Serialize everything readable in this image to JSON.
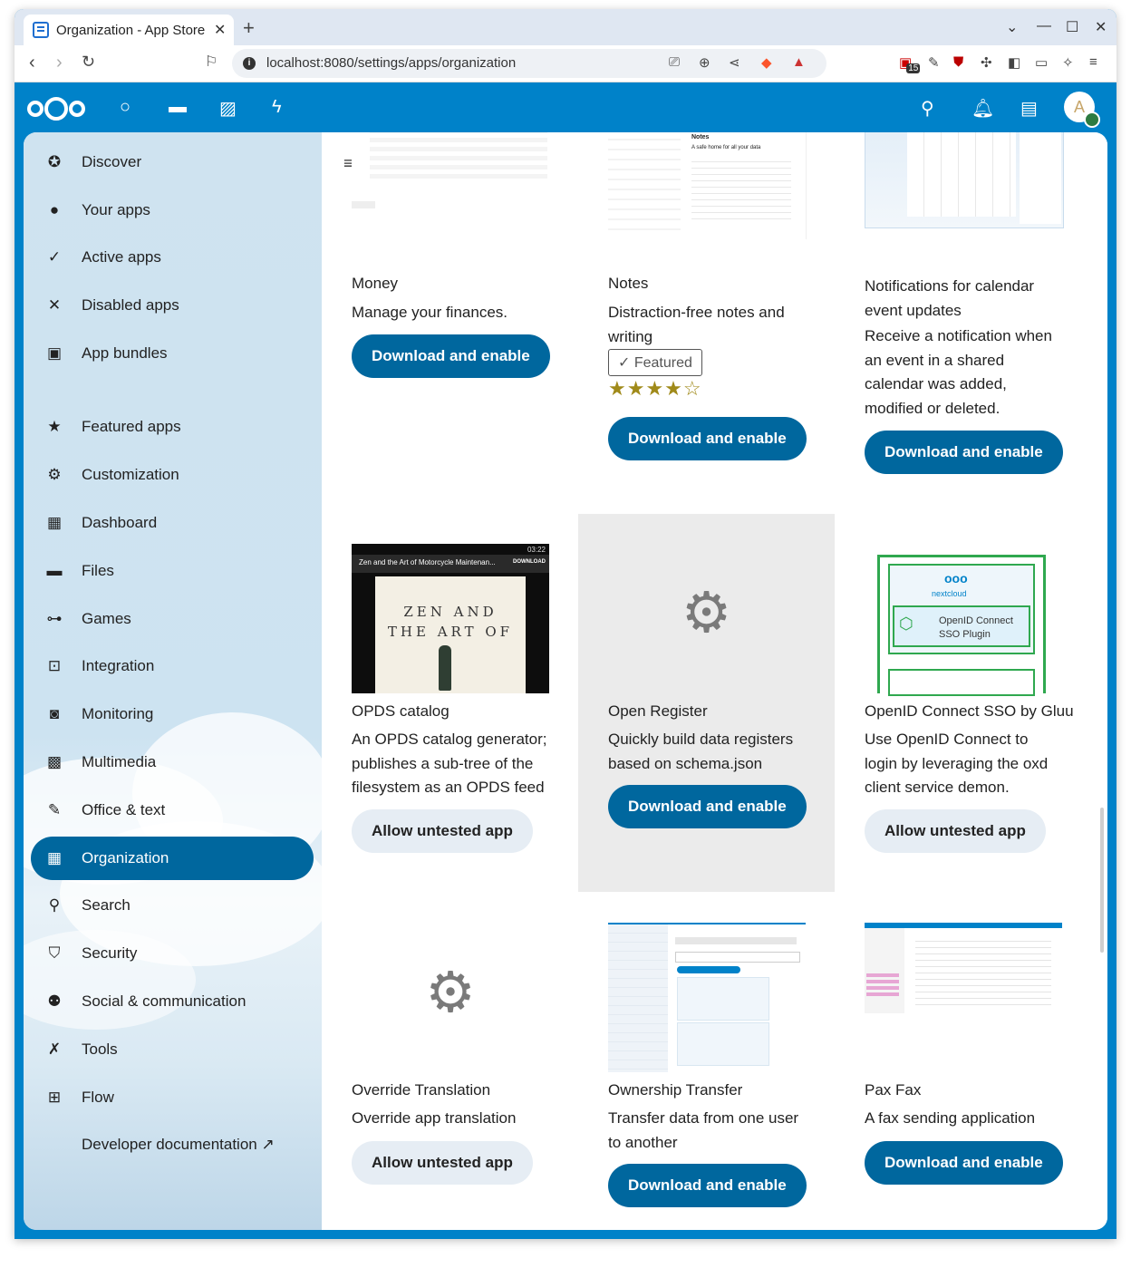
{
  "browser": {
    "tab_title": "Organization - App Store",
    "new_tab": "+",
    "url": "localhost:8080/settings/apps/organization",
    "badge_count": "15"
  },
  "sidebar": {
    "items": [
      {
        "label": "Discover",
        "icon": "discover-icon"
      },
      {
        "label": "Your apps",
        "icon": "user-icon"
      },
      {
        "label": "Active apps",
        "icon": "check-icon"
      },
      {
        "label": "Disabled apps",
        "icon": "close-icon"
      },
      {
        "label": "App bundles",
        "icon": "archive-icon"
      },
      {
        "label": "Featured apps",
        "icon": "star-icon"
      },
      {
        "label": "Customization",
        "icon": "gear-icon"
      },
      {
        "label": "Dashboard",
        "icon": "dashboard-icon"
      },
      {
        "label": "Files",
        "icon": "folder-icon"
      },
      {
        "label": "Games",
        "icon": "gamepad-icon"
      },
      {
        "label": "Integration",
        "icon": "integration-icon"
      },
      {
        "label": "Monitoring",
        "icon": "monitor-icon"
      },
      {
        "label": "Multimedia",
        "icon": "multimedia-icon"
      },
      {
        "label": "Office & text",
        "icon": "document-icon"
      },
      {
        "label": "Organization",
        "icon": "organization-icon"
      },
      {
        "label": "Search",
        "icon": "search-icon"
      },
      {
        "label": "Security",
        "icon": "shield-icon"
      },
      {
        "label": "Social & communication",
        "icon": "people-icon"
      },
      {
        "label": "Tools",
        "icon": "tools-icon"
      },
      {
        "label": "Flow",
        "icon": "flow-icon"
      },
      {
        "label": "Developer documentation ↗",
        "icon": ""
      }
    ],
    "active": "Organization"
  },
  "apps": [
    {
      "name": "Money",
      "desc": "Manage your finances.",
      "button": "Download and enable"
    },
    {
      "name": "Notes",
      "desc": "Distraction-free notes and writing",
      "featured": "Featured",
      "rating": 4,
      "button": "Download and enable"
    },
    {
      "name": "Notifications for calendar event updates",
      "desc": "Receive a notification when an event in a shared calendar was added, modified or deleted.",
      "button": "Download and enable"
    },
    {
      "name": "OPDS catalog",
      "desc": "An OPDS catalog generator; publishes a sub-tree of the filesystem as an OPDS feed",
      "button": "Allow untested app",
      "preview_title": "Zen and the Art of Motorcycle Maintenan...",
      "preview_action": "DOWNLOAD",
      "preview_time": "03:22",
      "preview_cover": "ZEN AND THE ART OF"
    },
    {
      "name": "Open Register",
      "desc": "Quickly build data registers based on schema.json",
      "button": "Download and enable"
    },
    {
      "name": "OpenID Connect SSO by Gluu",
      "desc": "Use OpenID Connect to login by leveraging the oxd client service demon.",
      "button": "Allow untested app",
      "preview_brand": "nextcloud",
      "preview_plugin": "OpenID Connect SSO Plugin"
    },
    {
      "name": "Override Translation",
      "desc": "Override app translation",
      "button": "Allow untested app"
    },
    {
      "name": "Ownership Transfer",
      "desc": "Transfer data from one user to another",
      "button": "Download and enable"
    },
    {
      "name": "Pax Fax",
      "desc": "A fax sending application",
      "button": "Download and enable"
    }
  ],
  "colors": {
    "primary": "#0082c9",
    "button": "#00679e",
    "star": "#a08a1a"
  }
}
